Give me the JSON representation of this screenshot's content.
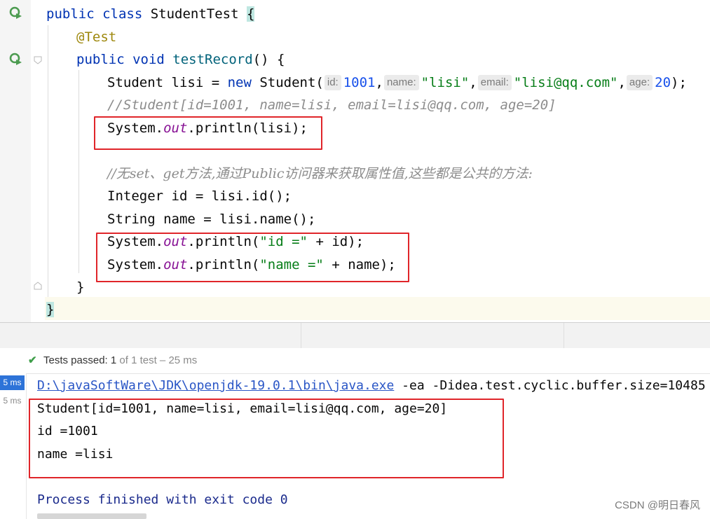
{
  "editor": {
    "lines": {
      "l1": {
        "kw": "public class ",
        "name": "StudentTest ",
        "brace": "{"
      },
      "l2": {
        "ann": "@Test"
      },
      "l3": {
        "kw": "public void ",
        "fn": "testRecord",
        "rest": "() {"
      },
      "l4": {
        "a": "Student lisi = ",
        "kw": "new ",
        "b": "Student(",
        "hint_id": "id:",
        "v_id": "1001",
        "c1": ",",
        "hint_name": "name:",
        "v_name": "\"lisi\"",
        "c2": ",",
        "hint_email": "email:",
        "v_email": "\"lisi@qq.com\"",
        "c3": ",",
        "hint_age": "age:",
        "v_age": "20",
        "end": ");"
      },
      "l5": {
        "comment": "//Student[id=1001, name=lisi, email=lisi@qq.com, age=20]"
      },
      "l6": {
        "a": "System.",
        "fld": "out",
        "b": ".println(lisi);"
      },
      "l8": {
        "comment": "//无set、get方法,通过Public访问器来获取属性值,这些都是公共的方法:"
      },
      "l9": {
        "text": "Integer id = lisi.id();"
      },
      "l10": {
        "text": "String name = lisi.name();"
      },
      "l11": {
        "a": "System.",
        "fld": "out",
        "b": ".println(",
        "str": "\"id =\"",
        "c": " + id);"
      },
      "l12": {
        "a": "System.",
        "fld": "out",
        "b": ".println(",
        "str": "\"name =\"",
        "c": " + name);"
      },
      "l13": {
        "text": "}"
      },
      "l14": {
        "brace": "}"
      }
    }
  },
  "run_panel": {
    "status_prefix": "Tests passed: ",
    "status_count": "1",
    "status_detail": " of 1 test – 25 ms",
    "badge_ms": "5 ms",
    "plain_ms": "5 ms"
  },
  "console": {
    "cmd_path": "D:\\javaSoftWare\\JDK\\openjdk-19.0.1\\bin\\java.exe",
    "cmd_args": " -ea -Didea.test.cyclic.buffer.size=10485",
    "out1": "Student[id=1001, name=lisi, email=lisi@qq.com, age=20]",
    "out2": "id =1001",
    "out3": "name =lisi",
    "exit": "Process finished with exit code 0"
  },
  "watermark": "CSDN @明日春风",
  "colors": {
    "highlight_box": "#e0252a",
    "pass_green": "#3f9e4a",
    "badge_blue": "#2d73d8"
  }
}
